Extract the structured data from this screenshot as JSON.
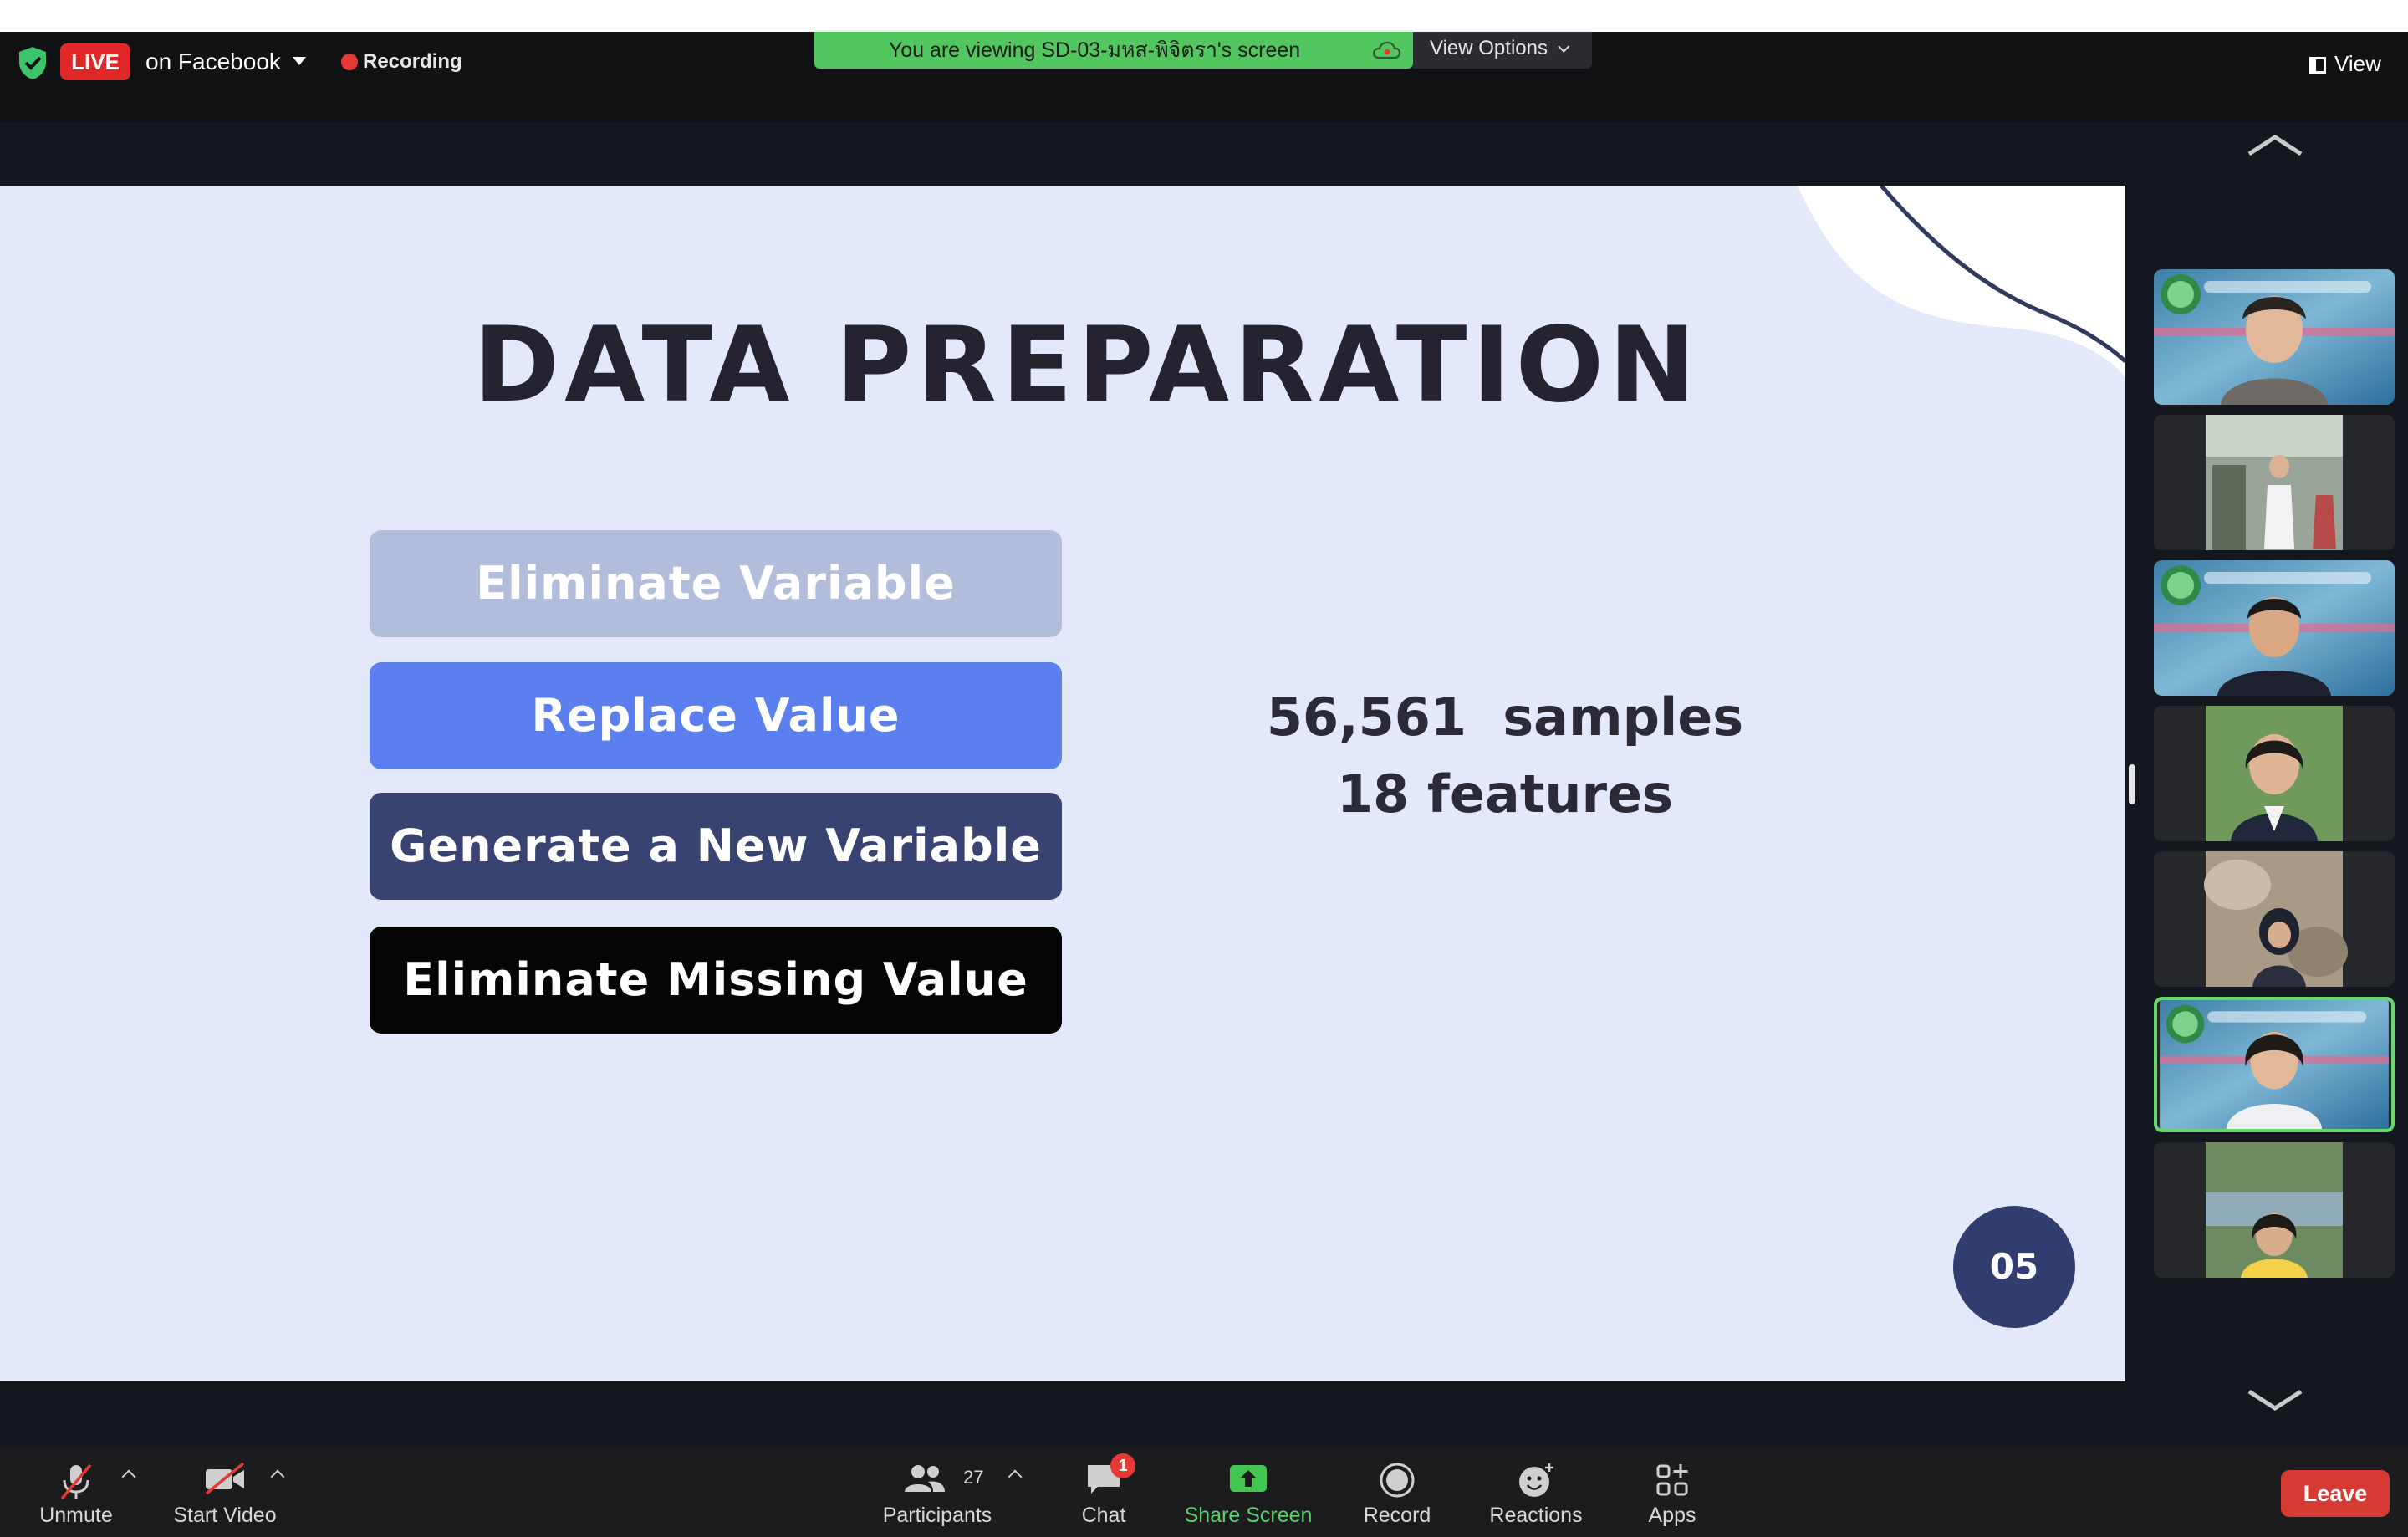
{
  "topbar": {
    "live_label": "LIVE",
    "live_destination": "on Facebook",
    "recording_label": "Recording",
    "viewing_banner": "You are viewing SD-03-มหส-พิจิตรา's screen",
    "view_options_label": "View Options",
    "view_label": "View"
  },
  "slide": {
    "title": "DATA PREPARATION",
    "steps": [
      "Eliminate Variable",
      "Replace Value",
      "Generate a New Variable",
      "Eliminate Missing Value"
    ],
    "stats": [
      "56,561  samples",
      "18 features"
    ],
    "page_number": "05"
  },
  "gallery": {
    "tile_count": 7,
    "active_tile_index": 5
  },
  "toolbar": {
    "unmute": "Unmute",
    "start_video": "Start Video",
    "participants": "Participants",
    "participants_count": "27",
    "chat": "Chat",
    "chat_badge": "1",
    "share_screen": "Share Screen",
    "record": "Record",
    "reactions": "Reactions",
    "apps": "Apps",
    "leave": "Leave"
  },
  "colors": {
    "live_red": "#e02828",
    "banner_green": "#52c760",
    "share_green": "#5ad26b",
    "leave_red": "#d63b33",
    "slide_bg": "#e3e9fa",
    "step_1": "#b2bddc",
    "step_2": "#5b7fef",
    "step_3": "#384371",
    "step_4": "#050505",
    "page_circle": "#313d6f"
  }
}
